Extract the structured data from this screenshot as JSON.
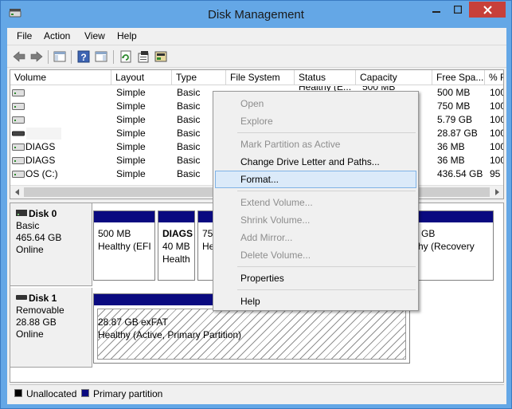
{
  "window": {
    "title": "Disk Management"
  },
  "menubar": [
    "File",
    "Action",
    "View",
    "Help"
  ],
  "toolbar": [
    "back-icon",
    "forward-icon",
    "show-hide-console-tree-icon",
    "help-icon",
    "show-hide-action-pane-icon",
    "refresh-icon",
    "properties-icon",
    "rescan-disks-icon"
  ],
  "volumes": {
    "columns": [
      "Volume",
      "Layout",
      "Type",
      "File System",
      "Status",
      "Capacity",
      "Free Spa...",
      "% F"
    ],
    "rows": [
      {
        "volume": "",
        "layout": "Simple",
        "type": "Basic",
        "fs": "",
        "status": "Healthy (E...",
        "capacity": "500 MB",
        "free": "500 MB",
        "pct": "100"
      },
      {
        "volume": "",
        "layout": "Simple",
        "type": "Basic",
        "fs": "",
        "status": "",
        "capacity": "",
        "free": "750 MB",
        "pct": "100"
      },
      {
        "volume": "",
        "layout": "Simple",
        "type": "Basic",
        "fs": "",
        "status": "",
        "capacity": "",
        "free": "5.79 GB",
        "pct": "100"
      },
      {
        "volume": "",
        "layout": "Simple",
        "type": "Basic",
        "fs": "",
        "status": "",
        "capacity": "",
        "free": "28.87 GB",
        "pct": "100"
      },
      {
        "volume": "DIAGS",
        "layout": "Simple",
        "type": "Basic",
        "fs": "",
        "status": "",
        "capacity": "",
        "free": "36 MB",
        "pct": "100"
      },
      {
        "volume": "DIAGS",
        "layout": "Simple",
        "type": "Basic",
        "fs": "",
        "status": "",
        "capacity": "",
        "free": "36 MB",
        "pct": "100"
      },
      {
        "volume": "OS (C:)",
        "layout": "Simple",
        "type": "Basic",
        "fs": "",
        "status": "",
        "capacity": "",
        "free": "436.54 GB",
        "pct": "95"
      }
    ]
  },
  "disks": [
    {
      "name": "Disk 0",
      "type": "Basic",
      "size": "465.64 GB",
      "state": "Online",
      "partitions": [
        {
          "line1": "500 MB",
          "line2": "Healthy (EFI"
        },
        {
          "line1": "DIAGS",
          "line2": "40 MB",
          "line3": "Health"
        },
        {
          "line1": "750",
          "line2": "He"
        },
        {
          "line1": "9 GB",
          "line2": "lthy (Recovery"
        }
      ]
    },
    {
      "name": "Disk 1",
      "type": "Removable",
      "size": "28.88 GB",
      "state": "Online",
      "partitions": [
        {
          "line1": "28.87 GB exFAT",
          "line2": "Healthy (Active, Primary Partition)"
        }
      ]
    }
  ],
  "legend": {
    "unallocated": "Unallocated",
    "primary": "Primary partition",
    "unallocated_color": "#000000",
    "primary_color": "#0a0a80"
  },
  "context_menu": {
    "open": "Open",
    "explore": "Explore",
    "mark_active": "Mark Partition as Active",
    "change_letter": "Change Drive Letter and Paths...",
    "format": "Format...",
    "extend": "Extend Volume...",
    "shrink": "Shrink Volume...",
    "add_mirror": "Add Mirror...",
    "delete": "Delete Volume...",
    "properties": "Properties",
    "help": "Help"
  }
}
